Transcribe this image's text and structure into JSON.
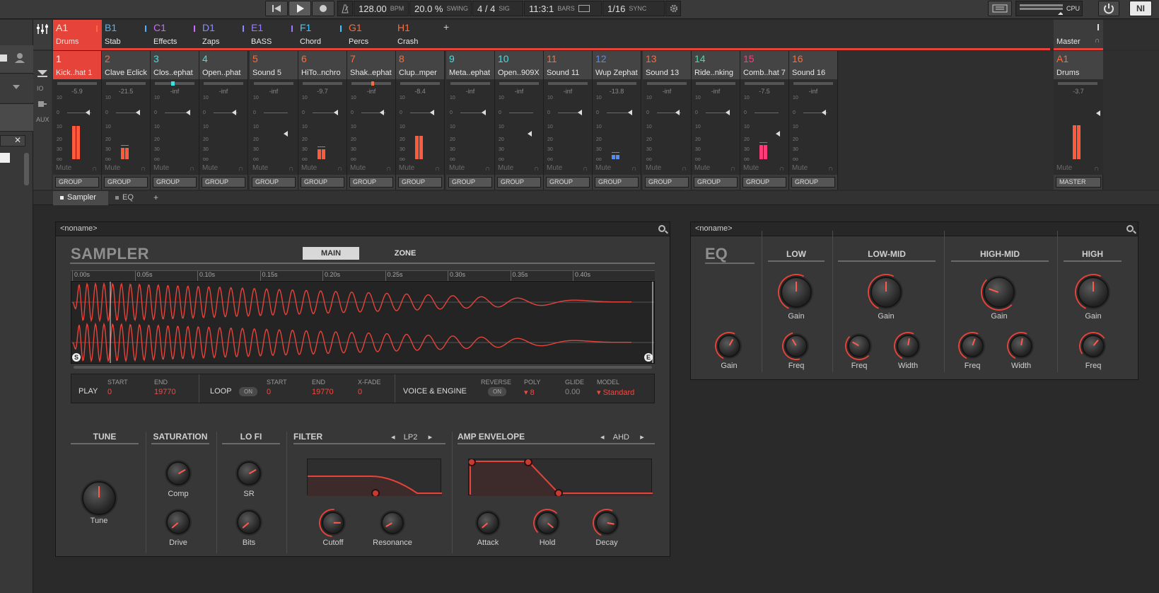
{
  "transport": {
    "bpm": "128.00",
    "bpm_label": "BPM",
    "swing": "20.0 %",
    "swing_label": "SWING",
    "sig": "4 / 4",
    "sig_label": "SIG",
    "position": "11:3:1",
    "bars_label": "BARS",
    "grid": "1/16",
    "sync_label": "SYNC",
    "cpu_label": "CPU",
    "ni_label": "NI"
  },
  "groups": [
    {
      "letter": "A1",
      "name": "Drums",
      "color": "#ff6a3c"
    },
    {
      "letter": "B1",
      "name": "Stab",
      "color": "#4fb3ff"
    },
    {
      "letter": "C1",
      "name": "Effects",
      "color": "#c86cff"
    },
    {
      "letter": "D1",
      "name": "Zaps",
      "color": "#8c8cff"
    },
    {
      "letter": "E1",
      "name": "BASS",
      "color": "#9a7bff"
    },
    {
      "letter": "F1",
      "name": "Chord",
      "color": "#3fc8ff"
    },
    {
      "letter": "G1",
      "name": "Percs",
      "color": "#ff6a3c"
    },
    {
      "letter": "H1",
      "name": "Crash",
      "color": "#ff6a3c"
    }
  ],
  "add_group": "+",
  "sounds": [
    {
      "num": "1",
      "name": "Kick..hat 1",
      "color": "#ff5a3c",
      "db": "-5.9",
      "level": 0.88
    },
    {
      "num": "2",
      "name": "Clave Eclick",
      "color": "#ff6a3c",
      "db": "-21.5",
      "level": 0.3
    },
    {
      "num": "3",
      "name": "Clos..ephat",
      "color": "#3fe0e0",
      "db": "-inf",
      "level": 0
    },
    {
      "num": "4",
      "name": "Open..phat",
      "color": "#3fe0e0",
      "db": "-inf",
      "level": 0
    },
    {
      "num": "5",
      "name": "Sound 5",
      "color": "#ff6a3c",
      "db": "-inf",
      "level": 0
    },
    {
      "num": "6",
      "name": "HiTo..nchro",
      "color": "#ff6a3c",
      "db": "-9.7",
      "level": 0.27
    },
    {
      "num": "7",
      "name": "Shak..ephat",
      "color": "#ff6a3c",
      "db": "-inf",
      "level": 0
    },
    {
      "num": "8",
      "name": "Clup..mper",
      "color": "#ff6a3c",
      "db": "-8.4",
      "level": 0.62
    },
    {
      "num": "9",
      "name": "Meta..ephat",
      "color": "#3fe0e0",
      "db": "-inf",
      "level": 0
    },
    {
      "num": "10",
      "name": "Open..909X",
      "color": "#3fe0e0",
      "db": "-inf",
      "level": 0
    },
    {
      "num": "11",
      "name": "Sound 11",
      "color": "#ff6a3c",
      "db": "-inf",
      "level": 0
    },
    {
      "num": "12",
      "name": "Wup Zephat",
      "color": "#4f8cff",
      "db": "-13.8",
      "level": 0.12
    },
    {
      "num": "13",
      "name": "Sound 13",
      "color": "#ff6a3c",
      "db": "-inf",
      "level": 0
    },
    {
      "num": "14",
      "name": "Ride..nking",
      "color": "#3fe0a0",
      "db": "-inf",
      "level": 0
    },
    {
      "num": "15",
      "name": "Comb..hat 7",
      "color": "#ff3c7a",
      "db": "-7.5",
      "level": 0.38
    },
    {
      "num": "16",
      "name": "Sound 16",
      "color": "#ff6a3c",
      "db": "-inf",
      "level": 0
    }
  ],
  "master": {
    "label": "Master",
    "group": "A1",
    "name": "Drums",
    "db": "-3.7",
    "level": 0.9,
    "button": "MASTER"
  },
  "mixer": {
    "mute": "Mute",
    "group_button": "GROUP",
    "scale": [
      "10",
      "0",
      "10",
      "20",
      "30",
      "oo"
    ],
    "io": "IO",
    "aux": "AUX"
  },
  "plugin_tabs": [
    {
      "label": "Sampler"
    },
    {
      "label": "EQ"
    }
  ],
  "plugin_add": "+",
  "sampler": {
    "preset": "<noname>",
    "title": "SAMPLER",
    "tab_main": "MAIN",
    "tab_zone": "ZONE",
    "ruler": [
      "0.00s",
      "0.05s",
      "0.10s",
      "0.15s",
      "0.20s",
      "0.25s",
      "0.30s",
      "0.35s",
      "0.40s"
    ],
    "start_marker": "S",
    "end_marker": "E",
    "play": {
      "label": "PLAY",
      "start_label": "START",
      "start": "0",
      "end_label": "END",
      "end": "19770"
    },
    "loop": {
      "label": "LOOP",
      "toggle": "ON",
      "start_label": "START",
      "start": "0",
      "end_label": "END",
      "end": "19770",
      "xfade_label": "X-FADE",
      "xfade": "0"
    },
    "voice": {
      "label": "VOICE & ENGINE",
      "reverse_label": "REVERSE",
      "reverse": "ON",
      "poly_label": "POLY",
      "poly": "8",
      "glide_label": "GLIDE",
      "glide": "0.00",
      "model_label": "MODEL",
      "model": "Standard"
    },
    "sections": {
      "tune": "TUNE",
      "saturation": "SATURATION",
      "lofi": "LO FI",
      "filter": "FILTER",
      "filter_type": "LP2",
      "amp": "AMP ENVELOPE",
      "amp_type": "AHD"
    },
    "knobs": {
      "tune": "Tune",
      "comp": "Comp",
      "drive": "Drive",
      "sr": "SR",
      "bits": "Bits",
      "cutoff": "Cutoff",
      "resonance": "Resonance",
      "attack": "Attack",
      "hold": "Hold",
      "decay": "Decay"
    }
  },
  "eq": {
    "preset": "<noname>",
    "title": "EQ",
    "bands": {
      "low": "LOW",
      "lowmid": "LOW-MID",
      "highmid": "HIGH-MID",
      "high": "HIGH"
    },
    "knobs": {
      "gain": "Gain",
      "freq": "Freq",
      "width": "Width"
    }
  },
  "colors": {
    "accent": "#e6433a",
    "background": "#2b2b2b"
  }
}
